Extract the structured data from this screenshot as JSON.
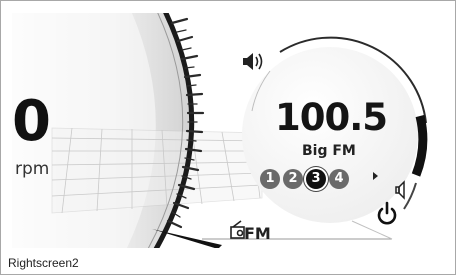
{
  "cluster": {
    "speed": "0",
    "speed_unit": "rpm"
  },
  "radio": {
    "frequency": "100.5",
    "station_name": "Big FM",
    "presets": [
      "1",
      "2",
      "3",
      "4"
    ],
    "selected_preset": "3",
    "source_label": "FM",
    "source_icon": "radio-icon",
    "volume_level_fraction": 0.25
  },
  "icons": {
    "volume_up": "speaker-loud-icon",
    "volume_down": "speaker-quiet-icon",
    "power": "power-icon",
    "next": "next-arrow-icon"
  },
  "caption": "Rightscreen2"
}
